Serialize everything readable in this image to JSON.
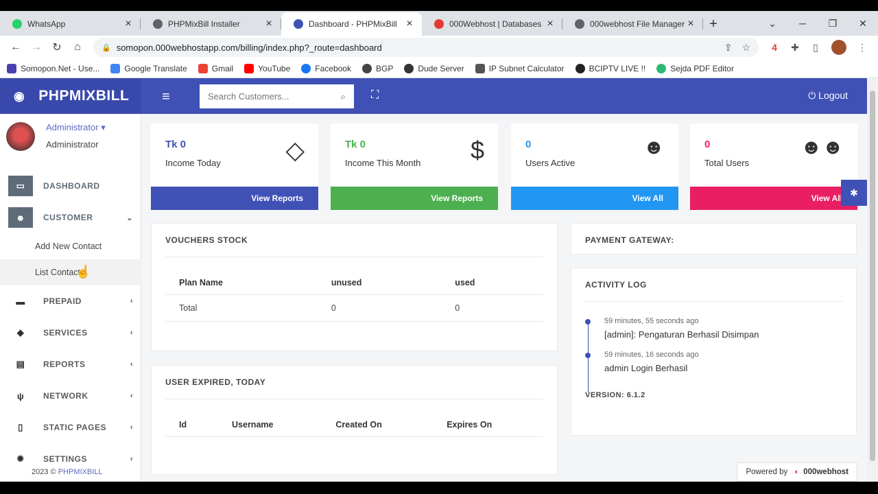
{
  "browser": {
    "tabs": [
      {
        "title": "WhatsApp",
        "color": "#25d366",
        "active": false
      },
      {
        "title": "PHPMixBill Installer",
        "color": "#5f6368",
        "active": false
      },
      {
        "title": "Dashboard - PHPMixBill",
        "color": "#3f51b5",
        "active": true
      },
      {
        "title": "000Webhost | Databases",
        "color": "#e53935",
        "active": false
      },
      {
        "title": "000webhost File Manager",
        "color": "#5f6368",
        "active": false
      }
    ],
    "url": "somopon.000webhostapp.com/billing/index.php?_route=dashboard",
    "bookmarks": [
      {
        "label": "Somopon.Net - Use...",
        "color": "#4a3fb0"
      },
      {
        "label": "Google Translate",
        "color": "#4285f4"
      },
      {
        "label": "Gmail",
        "color": "#ea4335"
      },
      {
        "label": "YouTube",
        "color": "#ff0000"
      },
      {
        "label": "Facebook",
        "color": "#1877f2"
      },
      {
        "label": "BGP",
        "color": "#444444"
      },
      {
        "label": "Dude Server",
        "color": "#333333"
      },
      {
        "label": "IP Subnet Calculator",
        "color": "#555555"
      },
      {
        "label": "BCIPTV LIVE !!",
        "color": "#222222"
      },
      {
        "label": "Sejda PDF Editor",
        "color": "#2eb872"
      }
    ]
  },
  "app": {
    "brand": "PHPMIXBILL",
    "search_placeholder": "Search Customers...",
    "logout": "Logout",
    "user": {
      "name": "Administrator",
      "role": "Administrator"
    },
    "menu": {
      "dashboard": "DASHBOARD",
      "customer": "CUSTOMER",
      "add_contact": "Add New Contact",
      "list_contact": "List Contact",
      "prepaid": "PREPAID",
      "services": "SERVICES",
      "reports": "REPORTS",
      "network": "NETWORK",
      "static_pages": "STATIC PAGES",
      "settings": "SETTINGS"
    },
    "copyright_prefix": "2023 ©",
    "copyright_brand": "PHPMIXBILL",
    "cards": [
      {
        "value": "Tk 0",
        "label": "Income Today",
        "footer": "View Reports",
        "color": "#3f51b5",
        "value_color": "#3f51b5"
      },
      {
        "value": "Tk 0",
        "label": "Income This Month",
        "footer": "View Reports",
        "color": "#4caf50",
        "value_color": "#4caf50"
      },
      {
        "value": "0",
        "label": "Users Active",
        "footer": "View All",
        "color": "#2196f3",
        "value_color": "#2196f3"
      },
      {
        "value": "0",
        "label": "Total Users",
        "footer": "View All",
        "color": "#e91e63",
        "value_color": "#e91e63"
      }
    ],
    "vouchers": {
      "title": "VOUCHERS STOCK",
      "headers": [
        "Plan Name",
        "unused",
        "used"
      ],
      "rows": [
        [
          "Total",
          "0",
          "0"
        ]
      ]
    },
    "expired": {
      "title": "USER EXPIRED, TODAY",
      "headers": [
        "Id",
        "Username",
        "Created On",
        "Expires On"
      ]
    },
    "payment_gateway": "PAYMENT GATEWAY:",
    "activity": {
      "title": "ACTIVITY LOG",
      "items": [
        {
          "time": "59 minutes, 55 seconds ago",
          "text": "[admin]: Pengaturan Berhasil Disimpan"
        },
        {
          "time": "59 minutes, 16 seconds ago",
          "text": "admin Login Berhasil"
        }
      ],
      "version": "VERSION: 6.1.2"
    },
    "powered_by": "Powered by",
    "powered_brand": "000webhost"
  }
}
